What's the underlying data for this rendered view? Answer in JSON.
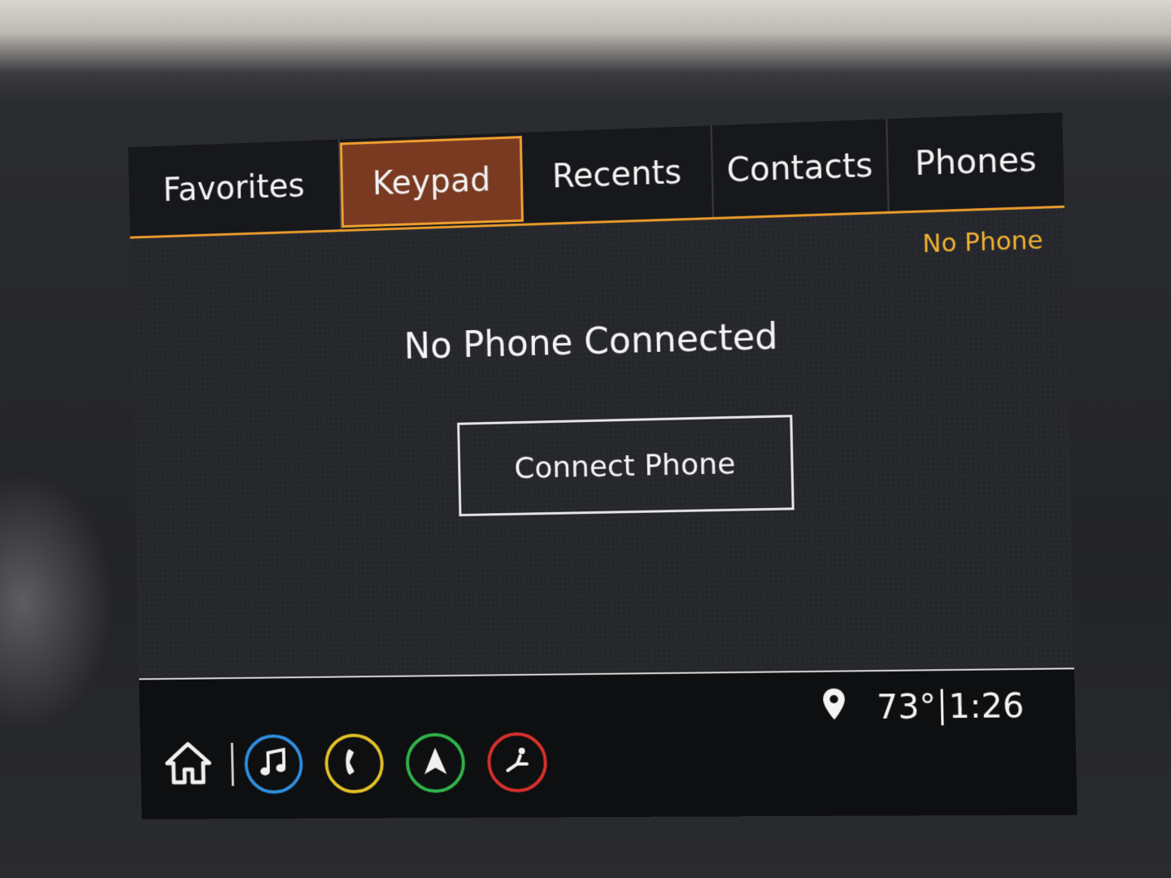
{
  "tabs": [
    {
      "label": "Favorites",
      "active": false
    },
    {
      "label": "Keypad",
      "active": true
    },
    {
      "label": "Recents",
      "active": false
    },
    {
      "label": "Contacts",
      "active": false
    },
    {
      "label": "Phones",
      "active": false
    }
  ],
  "status": {
    "phone_status": "No Phone"
  },
  "main": {
    "headline": "No Phone Connected",
    "connect_button_label": "Connect Phone"
  },
  "readout": {
    "temperature": "73°",
    "time": "1:26"
  },
  "dock": {
    "icons": [
      "home-icon",
      "music-note-icon",
      "phone-icon",
      "navigation-arrow-icon",
      "seat-app-icon"
    ],
    "colors": {
      "audio": "#2f8fe0",
      "phone": "#e2c128",
      "nav": "#31b34a",
      "app": "#d8302c"
    }
  },
  "colors": {
    "accent": "#e89a2c",
    "active_tab_bg": "#7a3a22",
    "status_text": "#f0b030"
  }
}
